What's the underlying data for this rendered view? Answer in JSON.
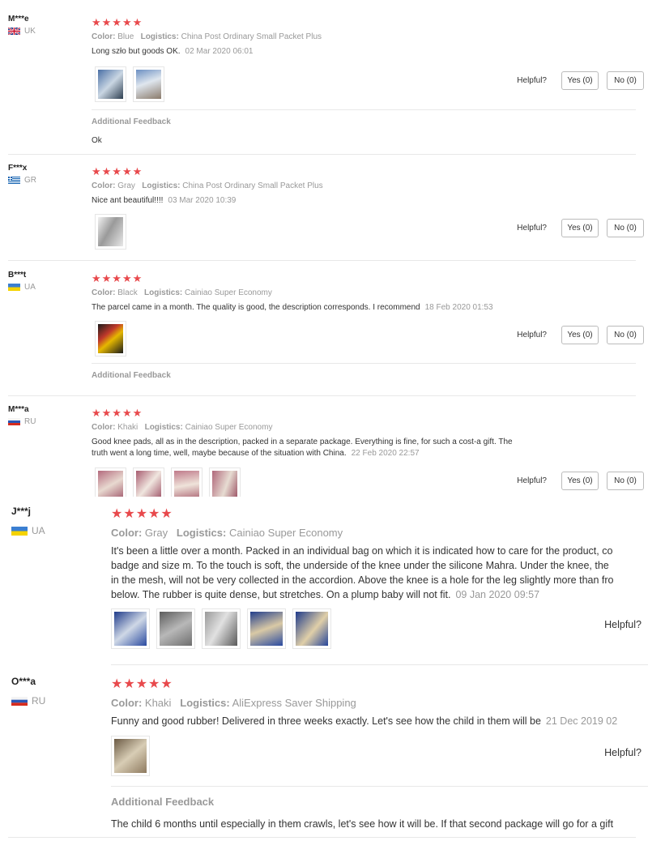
{
  "colors": {
    "star": "#e8494c",
    "muted": "#999999",
    "text": "#333333"
  },
  "labels": {
    "helpful": "Helpful?",
    "yes": "Yes (0)",
    "no": "No (0)",
    "color": "Color:",
    "logistics": "Logistics:",
    "additional_feedback": "Additional Feedback",
    "stars": "★★★★★"
  },
  "reviews": [
    {
      "user": "M***e",
      "country": "UK",
      "flag_icon": "uk-flag-icon",
      "color": "Blue",
      "logistics": "China Post Ordinary Small Packet Plus",
      "text": "Long szło but goods OK.",
      "date": "02 Mar 2020 06:01",
      "photo_count": 2,
      "additional_feedback": "Ok"
    },
    {
      "user": "F***x",
      "country": "GR",
      "flag_icon": "greece-flag-icon",
      "color": "Gray",
      "logistics": "China Post Ordinary Small Packet Plus",
      "text": "Nice ant beautiful!!!!",
      "date": "03 Mar 2020 10:39",
      "photo_count": 1
    },
    {
      "user": "B***t",
      "country": "UA",
      "flag_icon": "ukraine-flag-icon",
      "color": "Black",
      "logistics": "Cainiao Super Economy",
      "text": "The parcel came in a month. The quality is good, the description corresponds. I recommend",
      "date": "18 Feb 2020 01:53",
      "photo_count": 1,
      "additional_feedback": ""
    },
    {
      "user": "M***a",
      "country": "RU",
      "flag_icon": "russia-flag-icon",
      "color": "Khaki",
      "logistics": "Cainiao Super Economy",
      "text_lines": [
        "Good knee pads, all as in the description, packed in a separate package. Everything is fine, for such a cost-a gift. The",
        "truth went a long time, well, maybe because of the situation with China."
      ],
      "date": "22 Feb 2020 22:57",
      "photo_count": 4
    },
    {
      "user": "J***j",
      "country": "UA",
      "flag_icon": "ukraine-flag-icon",
      "color": "Gray",
      "logistics": "Cainiao Super Economy",
      "text_lines": [
        "It's been a little over a month. Packed in an individual bag on which it is indicated how to care for the product, co",
        "badge and size m. To the touch is soft, the underside of the knee under the silicone Mahra. Under the knee, the",
        "in the mesh, will not be very collected in the accordion. Above the knee is a hole for the leg slightly more than fro",
        "below. The rubber is quite dense, but stretches. On a plump baby will not fit."
      ],
      "date": "09 Jan 2020 09:57",
      "photo_count": 5
    },
    {
      "user": "O***a",
      "country": "RU",
      "flag_icon": "russia-flag-icon",
      "color": "Khaki",
      "logistics": "AliExpress Saver Shipping",
      "text": "Funny and good rubber! Delivered in three weeks exactly. Let's see how the child in them will be",
      "date": "21 Dec 2019 02",
      "photo_count": 1,
      "additional_feedback": "The child 6 months until especially in them crawls, let's see how it will be. If that second package will go for a gift"
    }
  ]
}
